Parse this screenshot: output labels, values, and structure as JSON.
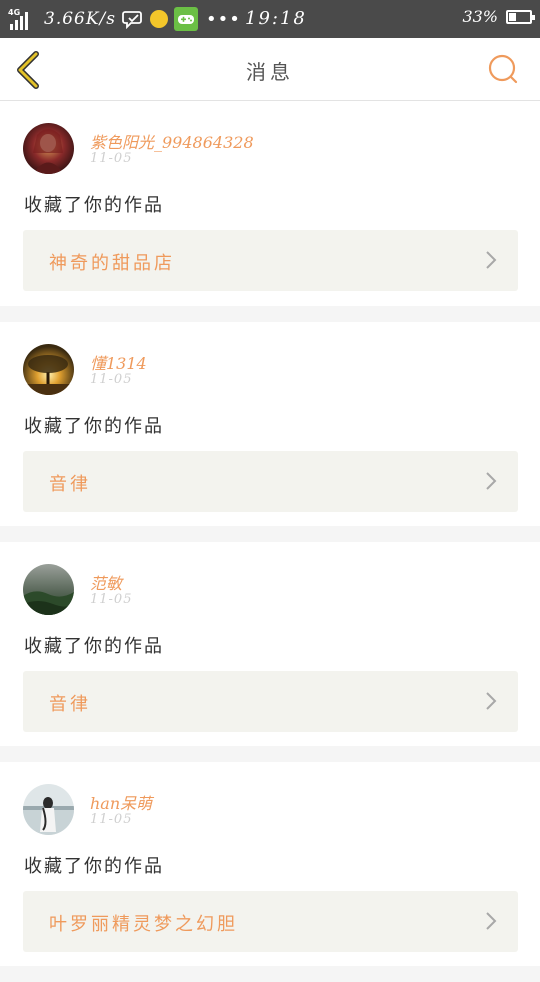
{
  "status_bar": {
    "network": "4G",
    "speed": "3.66K/s",
    "time": "19:18",
    "battery_pct": "33%",
    "battery_level": 0.33
  },
  "nav": {
    "title": "消息",
    "back_icon": "chevron-left-icon",
    "search_icon": "search-icon"
  },
  "colors": {
    "accent": "#ef9a5c",
    "back_arrow": "#d4b21c",
    "work_bg": "#f3f3ee",
    "date": "#cfcfcf"
  },
  "messages": [
    {
      "user": "紫色阳光_994864328",
      "date": "11-05",
      "action": "收藏了你的作品",
      "work": "神奇的甜品店"
    },
    {
      "user": "懂1314",
      "date": "11-05",
      "action": "收藏了你的作品",
      "work": "音律"
    },
    {
      "user": "范敏",
      "date": "11-05",
      "action": "收藏了你的作品",
      "work": "音律"
    },
    {
      "user": "han呆萌",
      "date": "11-05",
      "action": "收藏了你的作品",
      "work": "叶罗丽精灵梦之幻胆"
    }
  ]
}
